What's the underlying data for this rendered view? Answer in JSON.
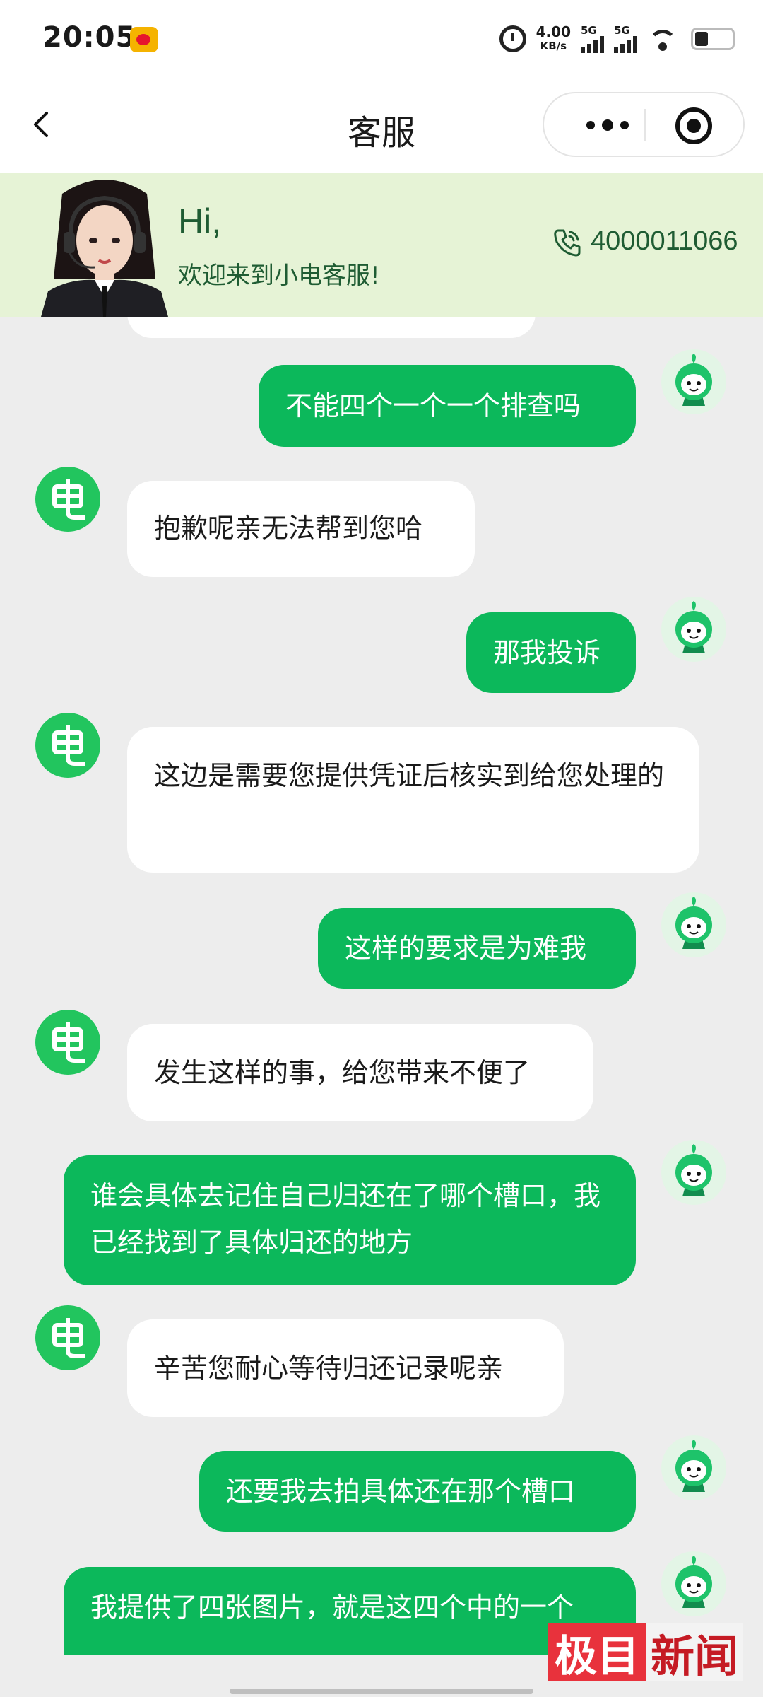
{
  "status_bar": {
    "time": "20:05",
    "net_speed_value": "4.00",
    "net_speed_unit": "KB/s",
    "sim1_label": "5G",
    "sim2_label": "5G",
    "battery_level": 0.35
  },
  "navbar": {
    "title": "客服"
  },
  "banner": {
    "greeting": "Hi,",
    "welcome": "欢迎来到小电客服!",
    "phone": "4000011066"
  },
  "colors": {
    "accent_green": "#0cb85b",
    "banner_bg": "#e6f3d6",
    "banner_text": "#1f5c33",
    "chat_bg": "#ededed"
  },
  "messages": [
    {
      "from": "user",
      "text": "不能四个一个一个排查吗"
    },
    {
      "from": "agent",
      "text": "抱歉呢亲无法帮到您哈"
    },
    {
      "from": "user",
      "text": "那我投诉"
    },
    {
      "from": "agent",
      "text": "这边是需要您提供凭证后核实到给您处理的"
    },
    {
      "from": "user",
      "text": "这样的要求是为难我"
    },
    {
      "from": "agent",
      "text": "发生这样的事，给您带来不便了"
    },
    {
      "from": "user",
      "text": "谁会具体去记住自己归还在了哪个槽口，我已经找到了具体归还的地方"
    },
    {
      "from": "agent",
      "text": "辛苦您耐心等待归还记录呢亲"
    },
    {
      "from": "user",
      "text": "还要我去拍具体还在那个槽口"
    },
    {
      "from": "user",
      "text": "我提供了四张图片，就是这四个中的一个"
    }
  ],
  "agent_avatar_icon": "dian-logo-icon",
  "user_avatar_icon": "green-mascot-icon",
  "watermark": {
    "left": "极目",
    "right": "新闻"
  }
}
